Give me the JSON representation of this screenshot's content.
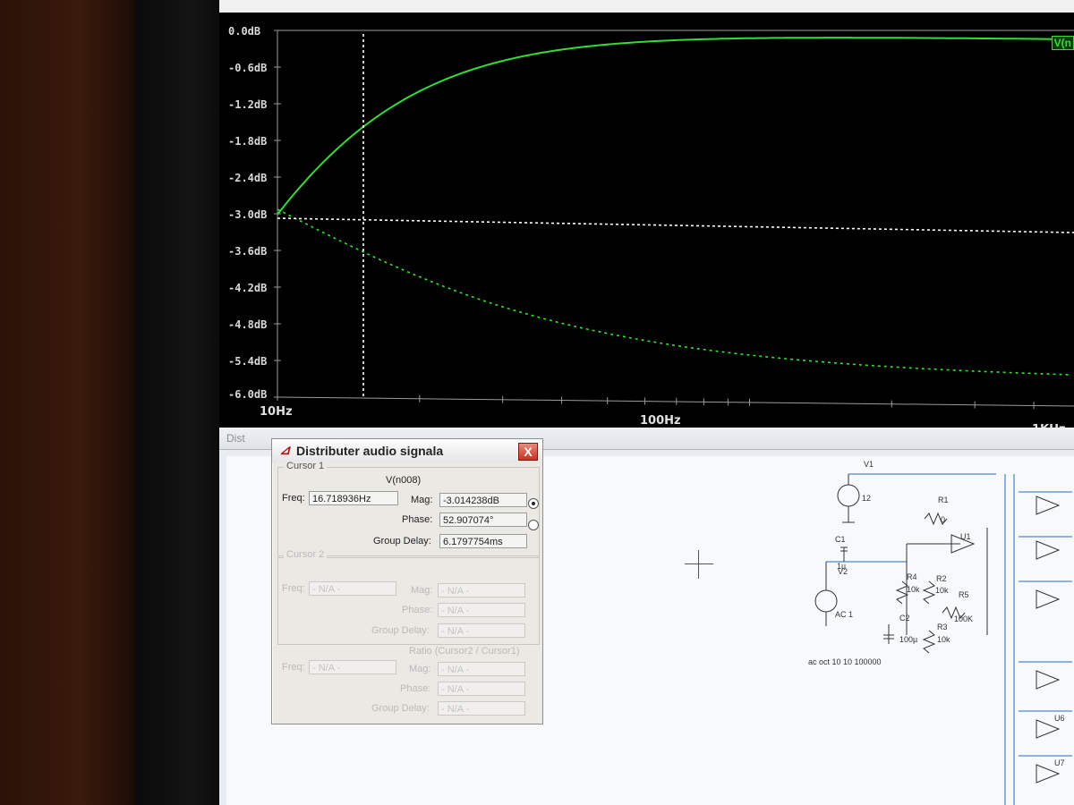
{
  "plot": {
    "y_labels": [
      "0.0dB",
      "-0.6dB",
      "-1.2dB",
      "-1.8dB",
      "-2.4dB",
      "-3.0dB",
      "-3.6dB",
      "-4.2dB",
      "-4.8dB",
      "-5.4dB",
      "-6.0dB"
    ],
    "x_labels": [
      "10Hz",
      "100Hz",
      "1KHz"
    ],
    "trace_label": "V(n",
    "colors": {
      "background": "#000000",
      "trace": "#33dd33",
      "cursor": "#ffffff"
    }
  },
  "lower_tab": {
    "label": "Dist"
  },
  "dialog": {
    "title": "Distributer audio signala",
    "close_label": "X",
    "cursor1": {
      "group_label": "Cursor 1",
      "trace_name": "V(n008)",
      "freq_label": "Freq:",
      "freq_value": "16.718936Hz",
      "mag_label": "Mag:",
      "mag_value": "-3.014238dB",
      "phase_label": "Phase:",
      "phase_value": "52.907074°",
      "group_delay_label": "Group Delay:",
      "group_delay_value": "6.1797754ms"
    },
    "cursor2": {
      "group_label": "Cursor 2",
      "freq_label": "Freq:",
      "freq_value": "- N/A -",
      "mag_label": "Mag:",
      "mag_value": "- N/A -",
      "phase_label": "Phase:",
      "phase_value": "- N/A -",
      "group_delay_label": "Group Delay:",
      "group_delay_value": "- N/A -"
    },
    "ratio": {
      "label": "Ratio (Cursor2 / Cursor1)",
      "freq_label": "Freq:",
      "freq_value": "- N/A -",
      "mag_label": "Mag:",
      "mag_value": "- N/A -",
      "phase_label": "Phase:",
      "phase_value": "- N/A -",
      "group_delay_label": "Group Delay:",
      "group_delay_value": "- N/A -"
    }
  },
  "schematic": {
    "v1": "V1",
    "v1_value": "12",
    "r1": "R1",
    "r1_value": "0",
    "c1": "C1",
    "c1_value": "1µ",
    "v2": "V2",
    "v2_value": "AC 1",
    "r4": "R4",
    "r4_value": "10k",
    "r2": "R2",
    "r2_value": "10k",
    "r5": "R5",
    "r5_value": "100K",
    "c2": "C2",
    "c2_value": "100µ",
    "r3": "R3",
    "r3_value": "10k",
    "directive": "ac oct 10 10 100000",
    "u1": "U1",
    "u6": "U6",
    "u7": "U7"
  }
}
